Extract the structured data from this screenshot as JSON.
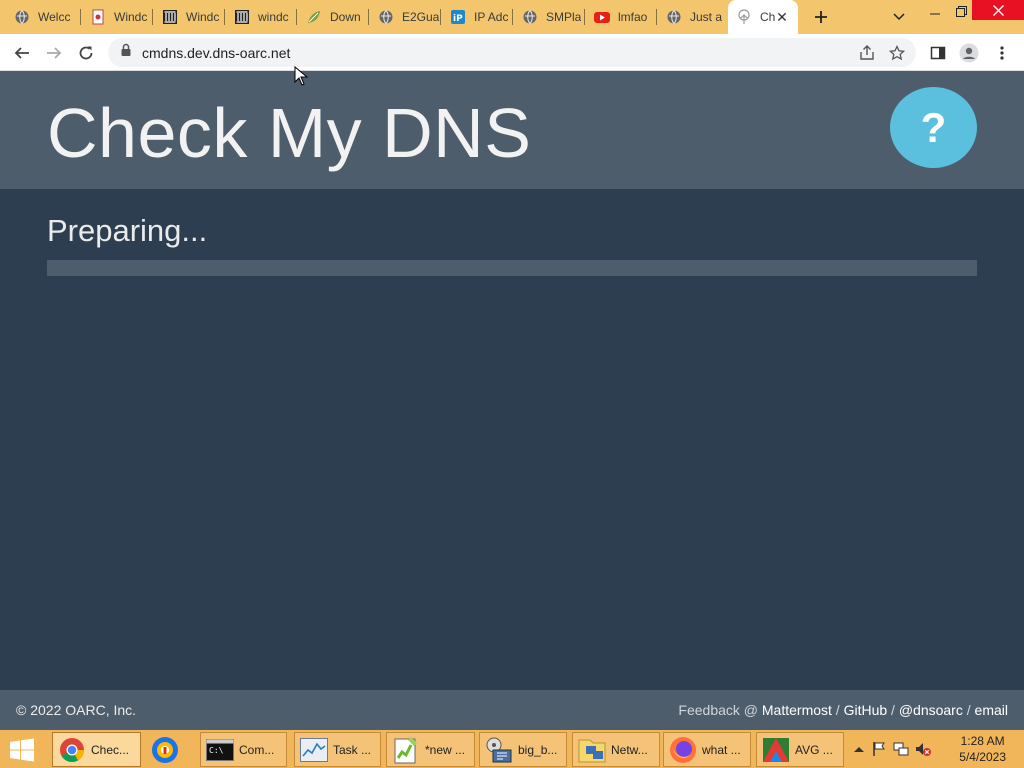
{
  "browser": {
    "tabs": [
      {
        "label": "Welcc",
        "icon": "globe-icon"
      },
      {
        "label": "Windc",
        "icon": "card-icon"
      },
      {
        "label": "Windc",
        "icon": "building-icon"
      },
      {
        "label": "windc",
        "icon": "building-icon"
      },
      {
        "label": "Down",
        "icon": "leaf-icon"
      },
      {
        "label": "E2Gua",
        "icon": "globe-icon"
      },
      {
        "label": "IP Adc",
        "icon": "ip-icon"
      },
      {
        "label": "SMPla",
        "icon": "globe-icon"
      },
      {
        "label": "lmfao",
        "icon": "youtube-icon"
      },
      {
        "label": "Just a",
        "icon": "globe-icon"
      },
      {
        "label": "Ch",
        "icon": "tree-icon",
        "active": true
      }
    ],
    "address_bar": {
      "url": "cmdns.dev.dns-oarc.net"
    }
  },
  "page": {
    "title": "Check My DNS",
    "help_label": "?",
    "status": "Preparing...",
    "progress_percent": 0
  },
  "footer": {
    "copyright": "© 2022 OARC, Inc.",
    "feedback_prefix": "Feedback @",
    "links": [
      "Mattermost",
      "GitHub",
      "@dnsoarc",
      "email"
    ]
  },
  "taskbar": {
    "items": [
      {
        "label": "Chec...",
        "icon": "chrome-icon",
        "active": true
      },
      {
        "label": "",
        "icon": "browser-icon"
      },
      {
        "label": "Com...",
        "icon": "cmd-icon"
      },
      {
        "label": "Task ...",
        "icon": "task-manager-icon"
      },
      {
        "label": "*new ...",
        "icon": "notepadpp-icon"
      },
      {
        "label": "big_b...",
        "icon": "media-icon"
      },
      {
        "label": "Netw...",
        "icon": "network-icon"
      },
      {
        "label": "what ...",
        "icon": "firefox-icon"
      },
      {
        "label": "AVG ...",
        "icon": "avg-icon"
      }
    ],
    "clock": {
      "time": "1:28 AM",
      "date": "5/4/2023"
    }
  },
  "colors": {
    "page_bg": "#2c3e50",
    "header_bg": "#4e5d6c",
    "help_button": "#5bc0de",
    "tab_strip": "#f3c66e",
    "taskbar": "#f2b65a"
  }
}
